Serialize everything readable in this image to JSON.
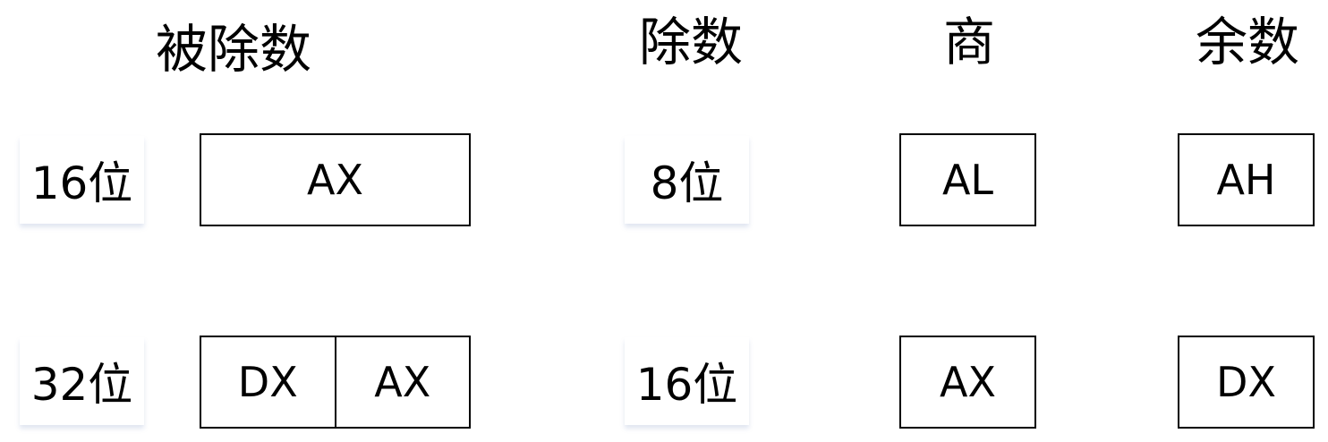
{
  "headers": {
    "dividend": "被除数",
    "divisor": "除数",
    "quotient": "商",
    "remainder": "余数"
  },
  "rows": [
    {
      "dividend_size": "16位",
      "dividend_registers": [
        "AX"
      ],
      "divisor_size": "8位",
      "quotient": "AL",
      "remainder": "AH"
    },
    {
      "dividend_size": "32位",
      "dividend_registers": [
        "DX",
        "AX"
      ],
      "divisor_size": "16位",
      "quotient": "AX",
      "remainder": "DX"
    }
  ]
}
